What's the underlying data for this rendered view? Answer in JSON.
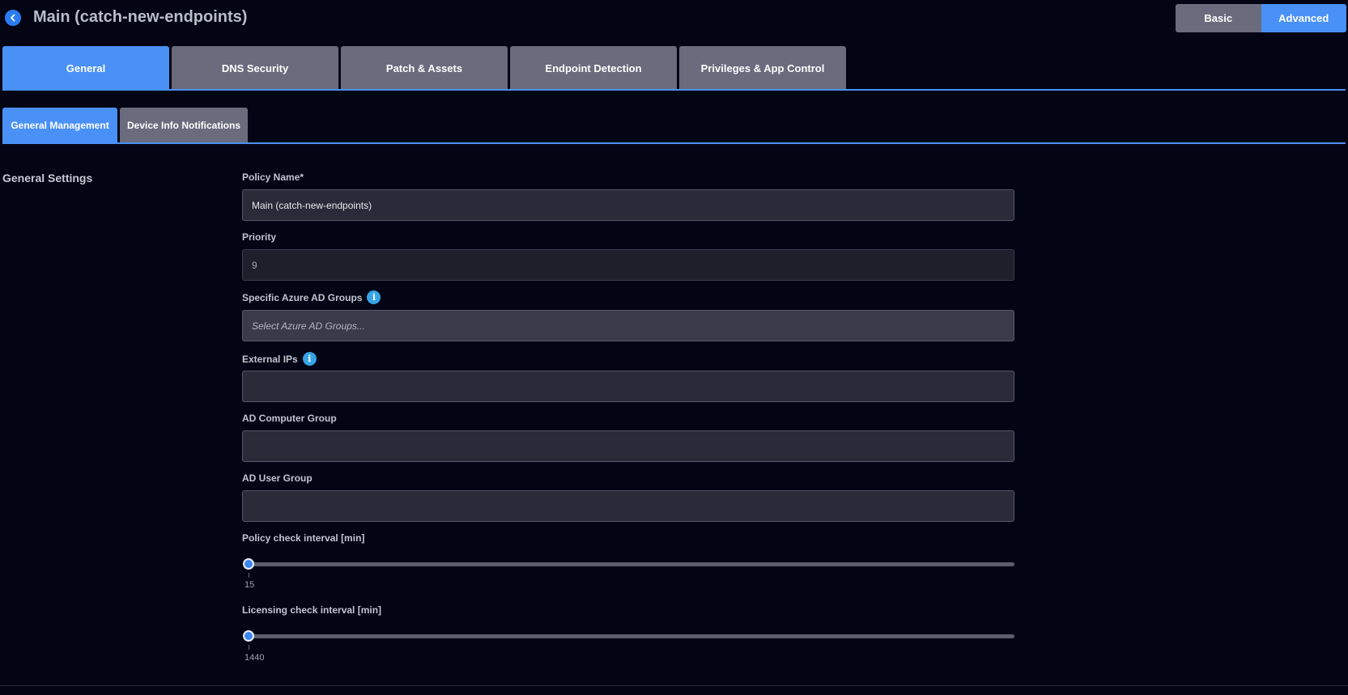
{
  "header": {
    "title": "Main (catch-new-endpoints)",
    "modes": {
      "basic_label": "Basic",
      "advanced_label": "Advanced",
      "active": "Advanced"
    },
    "accent_color": "#4a91f7"
  },
  "main_tabs": [
    {
      "label": "General",
      "active": true
    },
    {
      "label": "DNS Security",
      "active": false
    },
    {
      "label": "Patch & Assets",
      "active": false
    },
    {
      "label": "Endpoint Detection",
      "active": false
    },
    {
      "label": "Privileges & App Control",
      "active": false
    }
  ],
  "sub_tabs": [
    {
      "label": "General Management",
      "active": true
    },
    {
      "label": "Device Info Notifications",
      "active": false
    }
  ],
  "section": {
    "title": "General Settings",
    "fields": {
      "policy_name": {
        "label": "Policy Name*",
        "value": "Main (catch-new-endpoints)"
      },
      "priority": {
        "label": "Priority",
        "value": "9"
      },
      "azure_groups": {
        "label": "Specific Azure AD Groups",
        "placeholder": "Select Azure AD Groups...",
        "info_icon": "info-icon"
      },
      "external_ips": {
        "label": "External IPs",
        "value": "",
        "info_icon": "info-icon"
      },
      "ad_computer_group": {
        "label": "AD Computer Group",
        "value": ""
      },
      "ad_user_group": {
        "label": "AD User Group",
        "value": ""
      },
      "policy_check_interval": {
        "label": "Policy check interval [min]",
        "value": "15",
        "fraction": 0
      },
      "licensing_check_interval": {
        "label": "Licensing check interval [min]",
        "value": "1440",
        "fraction": 0
      }
    }
  }
}
